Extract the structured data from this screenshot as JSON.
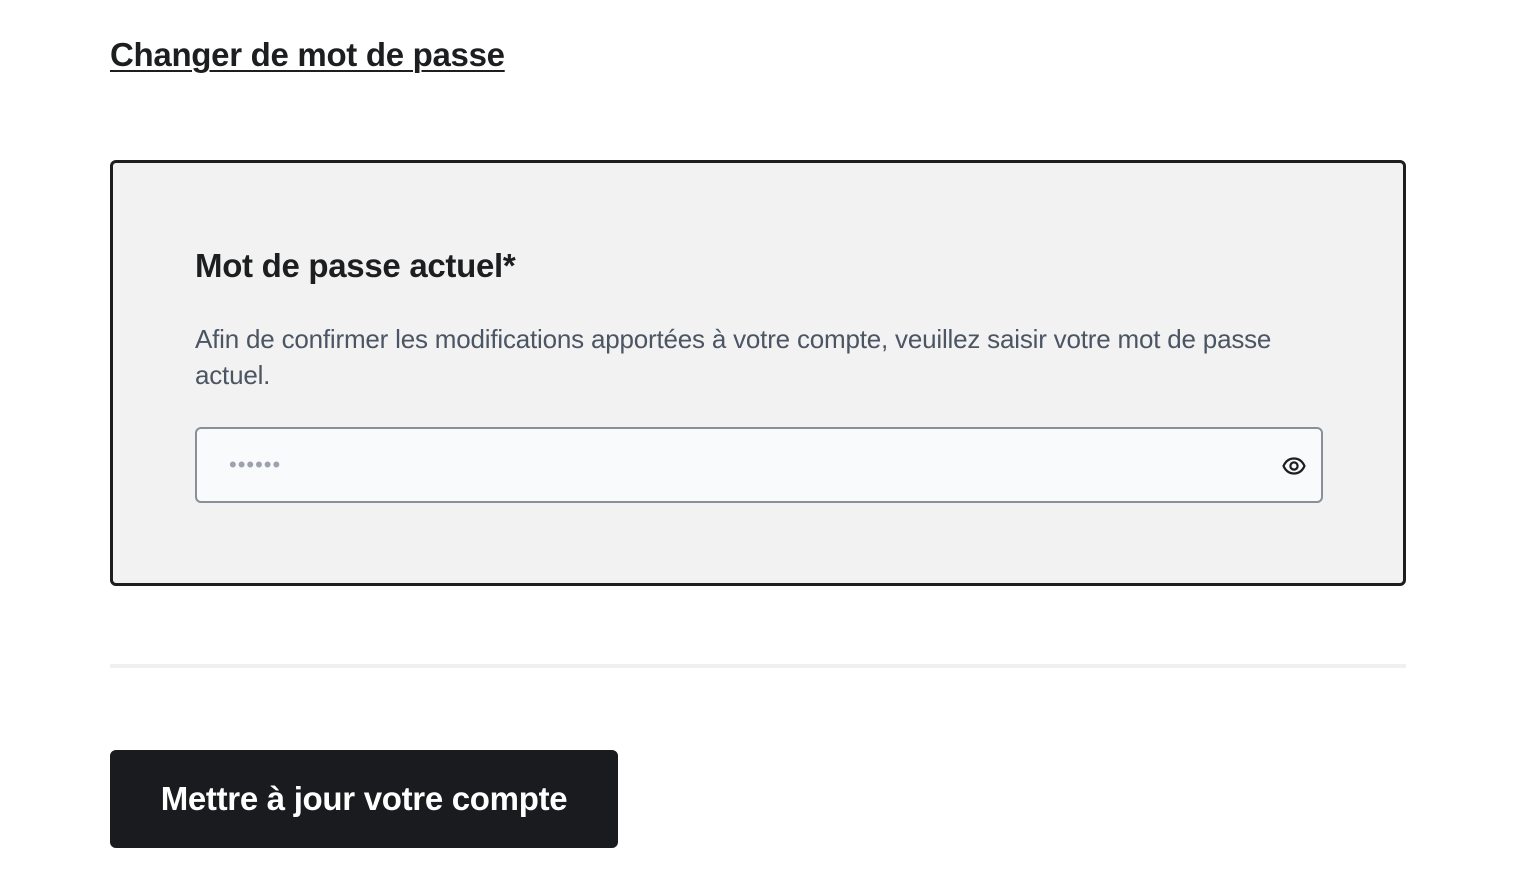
{
  "header": {
    "change_password_link": "Changer de mot de passe"
  },
  "current_password": {
    "label": "Mot de passe actuel*",
    "hint": "Afin de confirmer les modifications apportées à votre compte, veuillez saisir votre mot de passe actuel.",
    "placeholder": "••••••",
    "value": "",
    "toggle_icon": "eye-icon"
  },
  "actions": {
    "submit_label": "Mettre à jour votre compte"
  },
  "colors": {
    "panel_background": "#f2f2f2",
    "panel_border": "#1d1e20",
    "button_background": "#1a1b1e",
    "hint_text": "#4b5563"
  }
}
